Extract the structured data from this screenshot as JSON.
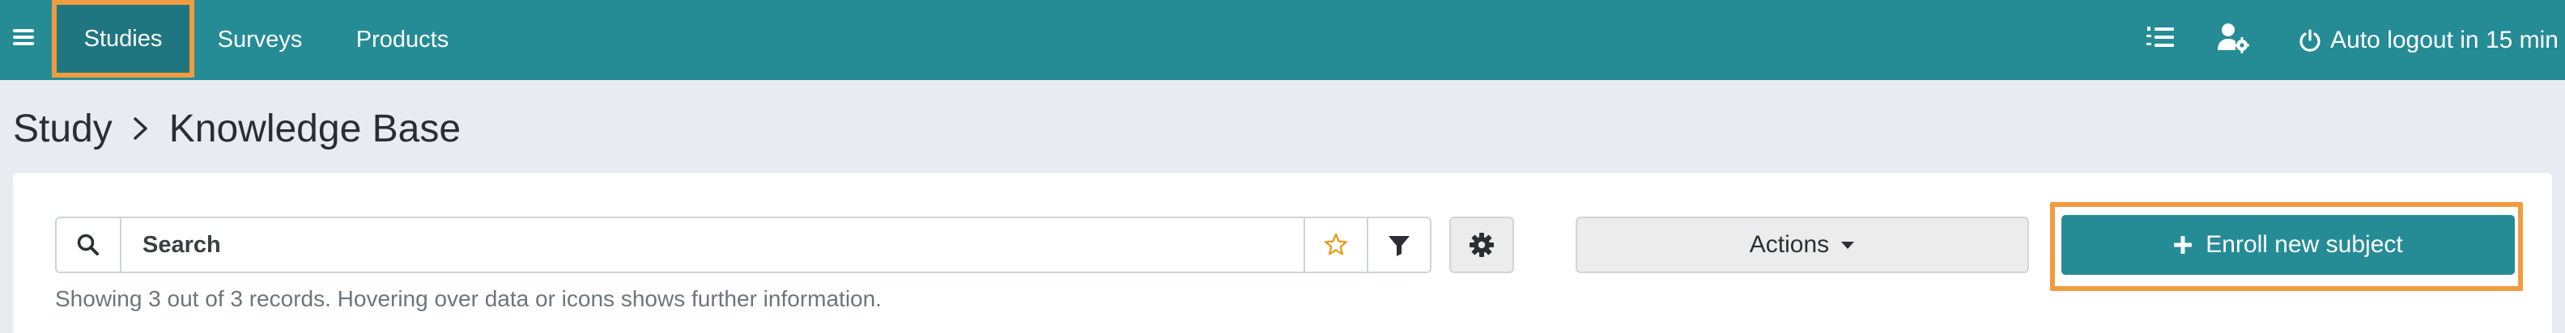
{
  "nav": {
    "menu_icon": "hamburger-menu-icon",
    "items": [
      {
        "label": "Studies",
        "active": true
      },
      {
        "label": "Surveys",
        "active": false
      },
      {
        "label": "Products",
        "active": false
      }
    ],
    "right": {
      "list_icon": "numbered-list-icon",
      "user_settings_icon": "user-gear-icon",
      "power_icon": "power-icon",
      "autologout_text": "Auto logout in 15 min"
    }
  },
  "breadcrumb": {
    "parent": "Study",
    "separator_icon": "chevron-right-icon",
    "current": "Knowledge Base"
  },
  "toolbar": {
    "search_icon": "search-icon",
    "search_placeholder": "Search",
    "search_value": "",
    "favorite_icon": "star-icon",
    "filter_icon": "filter-icon",
    "settings_icon": "gear-icon",
    "actions_label": "Actions",
    "actions_icon": "caret-down-icon",
    "enroll_label": "Enroll new subject",
    "enroll_icon": "plus-icon"
  },
  "records_info": "Showing 3 out of 3 records. Hovering over data or icons shows further information.",
  "colors": {
    "brand": "#258c96",
    "active_nav": "#1f7680",
    "highlight": "#f29b3f",
    "background": "#e8ebf2",
    "star": "#e0a022"
  }
}
